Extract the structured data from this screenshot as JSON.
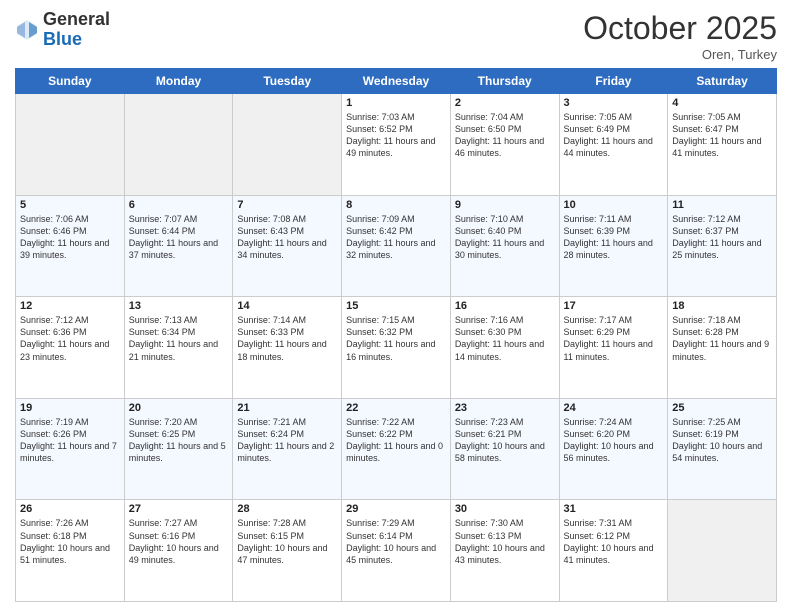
{
  "header": {
    "logo_general": "General",
    "logo_blue": "Blue",
    "month": "October 2025",
    "location": "Oren, Turkey"
  },
  "days_of_week": [
    "Sunday",
    "Monday",
    "Tuesday",
    "Wednesday",
    "Thursday",
    "Friday",
    "Saturday"
  ],
  "weeks": [
    [
      {
        "day": "",
        "info": ""
      },
      {
        "day": "",
        "info": ""
      },
      {
        "day": "",
        "info": ""
      },
      {
        "day": "1",
        "info": "Sunrise: 7:03 AM\nSunset: 6:52 PM\nDaylight: 11 hours\nand 49 minutes."
      },
      {
        "day": "2",
        "info": "Sunrise: 7:04 AM\nSunset: 6:50 PM\nDaylight: 11 hours\nand 46 minutes."
      },
      {
        "day": "3",
        "info": "Sunrise: 7:05 AM\nSunset: 6:49 PM\nDaylight: 11 hours\nand 44 minutes."
      },
      {
        "day": "4",
        "info": "Sunrise: 7:05 AM\nSunset: 6:47 PM\nDaylight: 11 hours\nand 41 minutes."
      }
    ],
    [
      {
        "day": "5",
        "info": "Sunrise: 7:06 AM\nSunset: 6:46 PM\nDaylight: 11 hours\nand 39 minutes."
      },
      {
        "day": "6",
        "info": "Sunrise: 7:07 AM\nSunset: 6:44 PM\nDaylight: 11 hours\nand 37 minutes."
      },
      {
        "day": "7",
        "info": "Sunrise: 7:08 AM\nSunset: 6:43 PM\nDaylight: 11 hours\nand 34 minutes."
      },
      {
        "day": "8",
        "info": "Sunrise: 7:09 AM\nSunset: 6:42 PM\nDaylight: 11 hours\nand 32 minutes."
      },
      {
        "day": "9",
        "info": "Sunrise: 7:10 AM\nSunset: 6:40 PM\nDaylight: 11 hours\nand 30 minutes."
      },
      {
        "day": "10",
        "info": "Sunrise: 7:11 AM\nSunset: 6:39 PM\nDaylight: 11 hours\nand 28 minutes."
      },
      {
        "day": "11",
        "info": "Sunrise: 7:12 AM\nSunset: 6:37 PM\nDaylight: 11 hours\nand 25 minutes."
      }
    ],
    [
      {
        "day": "12",
        "info": "Sunrise: 7:12 AM\nSunset: 6:36 PM\nDaylight: 11 hours\nand 23 minutes."
      },
      {
        "day": "13",
        "info": "Sunrise: 7:13 AM\nSunset: 6:34 PM\nDaylight: 11 hours\nand 21 minutes."
      },
      {
        "day": "14",
        "info": "Sunrise: 7:14 AM\nSunset: 6:33 PM\nDaylight: 11 hours\nand 18 minutes."
      },
      {
        "day": "15",
        "info": "Sunrise: 7:15 AM\nSunset: 6:32 PM\nDaylight: 11 hours\nand 16 minutes."
      },
      {
        "day": "16",
        "info": "Sunrise: 7:16 AM\nSunset: 6:30 PM\nDaylight: 11 hours\nand 14 minutes."
      },
      {
        "day": "17",
        "info": "Sunrise: 7:17 AM\nSunset: 6:29 PM\nDaylight: 11 hours\nand 11 minutes."
      },
      {
        "day": "18",
        "info": "Sunrise: 7:18 AM\nSunset: 6:28 PM\nDaylight: 11 hours\nand 9 minutes."
      }
    ],
    [
      {
        "day": "19",
        "info": "Sunrise: 7:19 AM\nSunset: 6:26 PM\nDaylight: 11 hours\nand 7 minutes."
      },
      {
        "day": "20",
        "info": "Sunrise: 7:20 AM\nSunset: 6:25 PM\nDaylight: 11 hours\nand 5 minutes."
      },
      {
        "day": "21",
        "info": "Sunrise: 7:21 AM\nSunset: 6:24 PM\nDaylight: 11 hours\nand 2 minutes."
      },
      {
        "day": "22",
        "info": "Sunrise: 7:22 AM\nSunset: 6:22 PM\nDaylight: 11 hours\nand 0 minutes."
      },
      {
        "day": "23",
        "info": "Sunrise: 7:23 AM\nSunset: 6:21 PM\nDaylight: 10 hours\nand 58 minutes."
      },
      {
        "day": "24",
        "info": "Sunrise: 7:24 AM\nSunset: 6:20 PM\nDaylight: 10 hours\nand 56 minutes."
      },
      {
        "day": "25",
        "info": "Sunrise: 7:25 AM\nSunset: 6:19 PM\nDaylight: 10 hours\nand 54 minutes."
      }
    ],
    [
      {
        "day": "26",
        "info": "Sunrise: 7:26 AM\nSunset: 6:18 PM\nDaylight: 10 hours\nand 51 minutes."
      },
      {
        "day": "27",
        "info": "Sunrise: 7:27 AM\nSunset: 6:16 PM\nDaylight: 10 hours\nand 49 minutes."
      },
      {
        "day": "28",
        "info": "Sunrise: 7:28 AM\nSunset: 6:15 PM\nDaylight: 10 hours\nand 47 minutes."
      },
      {
        "day": "29",
        "info": "Sunrise: 7:29 AM\nSunset: 6:14 PM\nDaylight: 10 hours\nand 45 minutes."
      },
      {
        "day": "30",
        "info": "Sunrise: 7:30 AM\nSunset: 6:13 PM\nDaylight: 10 hours\nand 43 minutes."
      },
      {
        "day": "31",
        "info": "Sunrise: 7:31 AM\nSunset: 6:12 PM\nDaylight: 10 hours\nand 41 minutes."
      },
      {
        "day": "",
        "info": ""
      }
    ]
  ]
}
